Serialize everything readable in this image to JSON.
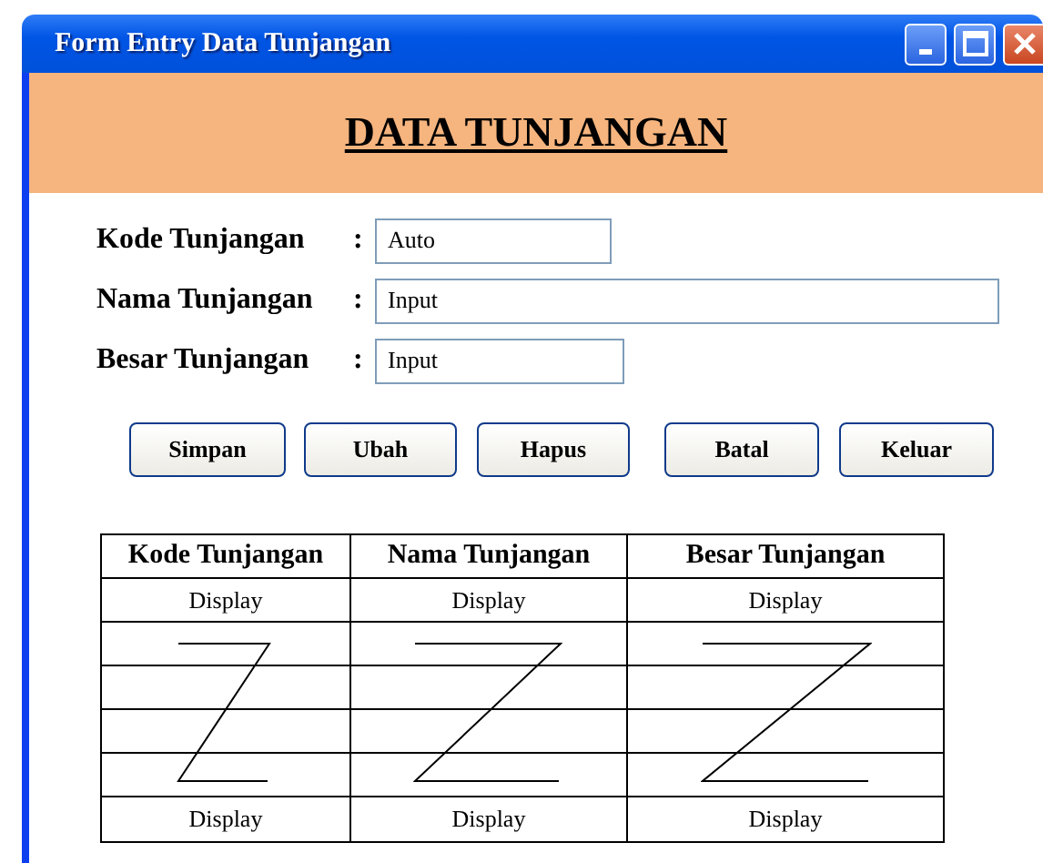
{
  "window": {
    "title": "Form Entry Data Tunjangan"
  },
  "heading": "DATA TUNJANGAN",
  "fields": [
    {
      "label": "Kode Tunjangan",
      "colon": ":",
      "value": "Auto"
    },
    {
      "label": "Nama Tunjangan",
      "colon": ":",
      "value": "Input"
    },
    {
      "label": "Besar Tunjangan",
      "colon": ":",
      "value": "Input"
    }
  ],
  "buttons": [
    "Simpan",
    "Ubah",
    "Hapus",
    "Batal",
    "Keluar"
  ],
  "table": {
    "columns": [
      "Kode Tunjangan",
      "Nama Tunjangan",
      "Besar Tunjangan"
    ],
    "rows": [
      [
        "Display",
        "Display",
        "Display"
      ],
      [
        "Display",
        "Display",
        "Display"
      ]
    ]
  }
}
